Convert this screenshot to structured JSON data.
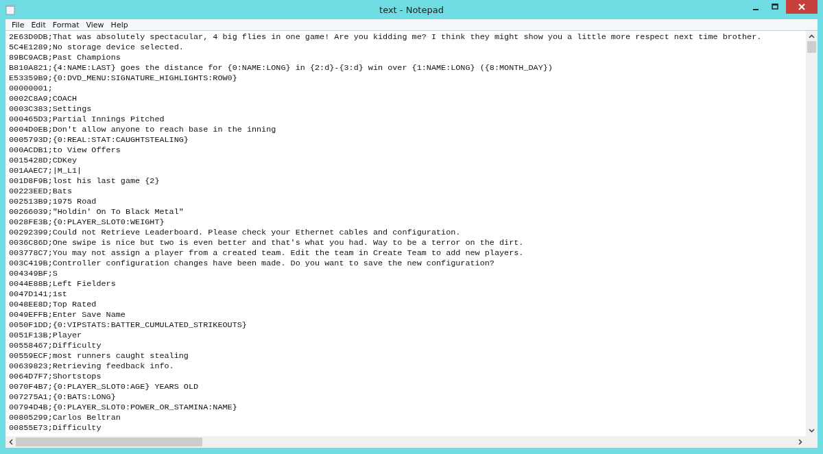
{
  "window": {
    "title": "text - Notepad"
  },
  "menu": [
    "File",
    "Edit",
    "Format",
    "View",
    "Help"
  ],
  "lines": [
    "2E63D0DB;That was absolutely spectacular, 4 big flies in one game! Are you kidding me? I think they might show you a little more respect next time brother.",
    "5C4E1289;No storage device selected.",
    "89BC9ACB;Past Champions",
    "B810A821;{4:NAME:LAST} goes the distance for {0:NAME:LONG} in {2:d}-{3:d} win over {1:NAME:LONG} ({8:MONTH_DAY})",
    "E53359B9;{0:DVD_MENU:SIGNATURE_HIGHLIGHTS:ROW0}",
    "00000001;",
    "0002C8A9;COACH",
    "0003C383;Settings",
    "000465D3;Partial Innings Pitched",
    "0004D0EB;Don't allow anyone to reach base in the inning",
    "0005793D;{0:REAL:STAT:CAUGHTSTEALING}",
    "000ACDB1;to View Offers",
    "0015428D;CDKey",
    "001AAEC7;|M_L1|",
    "001D8F9B;lost his last game {2}",
    "00223EED;Bats",
    "002513B9;1975 Road",
    "00266039;\"Holdin' On To Black Metal\"",
    "0028FE3B;{0:PLAYER_SLOT0:WEIGHT}",
    "00292399;Could not Retrieve Leaderboard. Please check your Ethernet cables and configuration.",
    "0036C86D;One swipe is nice but two is even better and that's what you had. Way to be a terror on the dirt.",
    "003778C7;You may not assign a player from a created team. Edit the team in Create Team to add new players.",
    "003C419B;Controller configuration changes have been made. Do you want to save the new configuration?",
    "004349BF;S",
    "0044E88B;Left Fielders",
    "0047D141;1st",
    "0048EE8D;Top Rated",
    "0049EFFB;Enter Save Name",
    "0050F1DD;{0:VIPSTATS:BATTER_CUMULATED_STRIKEOUTS}",
    "0051F13B;Player",
    "00558467;Difficulty",
    "00559ECF;most runners caught stealing",
    "00639823;Retrieving feedback info.",
    "0064D7F7;Shortstops",
    "0070F4B7;{0:PLAYER_SLOT0:AGE} YEARS OLD",
    "007275A1;{0:BATS:LONG}",
    "00794D4B;{0:PLAYER_SLOT0:POWER_OR_STAMINA:NAME}",
    "00805299;Carlos Beltran",
    "00855E73;Difficulty"
  ]
}
